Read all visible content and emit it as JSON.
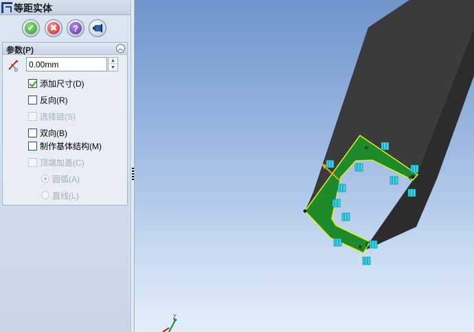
{
  "panel": {
    "title": "等距实体",
    "buttons": {
      "ok": "✔",
      "cancel": "✖",
      "help": "?",
      "pin": "pin-icon"
    },
    "group": {
      "title": "参数(P)",
      "distance_value": "0.00mm",
      "options": [
        {
          "label": "添加尺寸(D)",
          "checked": true,
          "enabled": true
        },
        {
          "label": "反向(R)",
          "checked": false,
          "enabled": true
        },
        {
          "label": "选择链(S)",
          "checked": false,
          "enabled": false
        },
        {
          "label": "双向(B)",
          "checked": false,
          "enabled": true
        },
        {
          "label": "制作基体结构(M)",
          "checked": false,
          "enabled": true
        },
        {
          "label": "顶端加盖(C)",
          "checked": false,
          "enabled": false
        }
      ],
      "radios": [
        {
          "label": "圆弧(A)",
          "selected": true,
          "enabled": false
        },
        {
          "label": "直线(L)",
          "selected": false,
          "enabled": false
        }
      ]
    }
  },
  "colors": {
    "sketch_fill": "#1e8a2a",
    "sketch_edge": "#e6f020",
    "solid": "#3a3a3a",
    "relation_marker": "#38d8ea"
  },
  "triad": {
    "y_label": "Y"
  }
}
